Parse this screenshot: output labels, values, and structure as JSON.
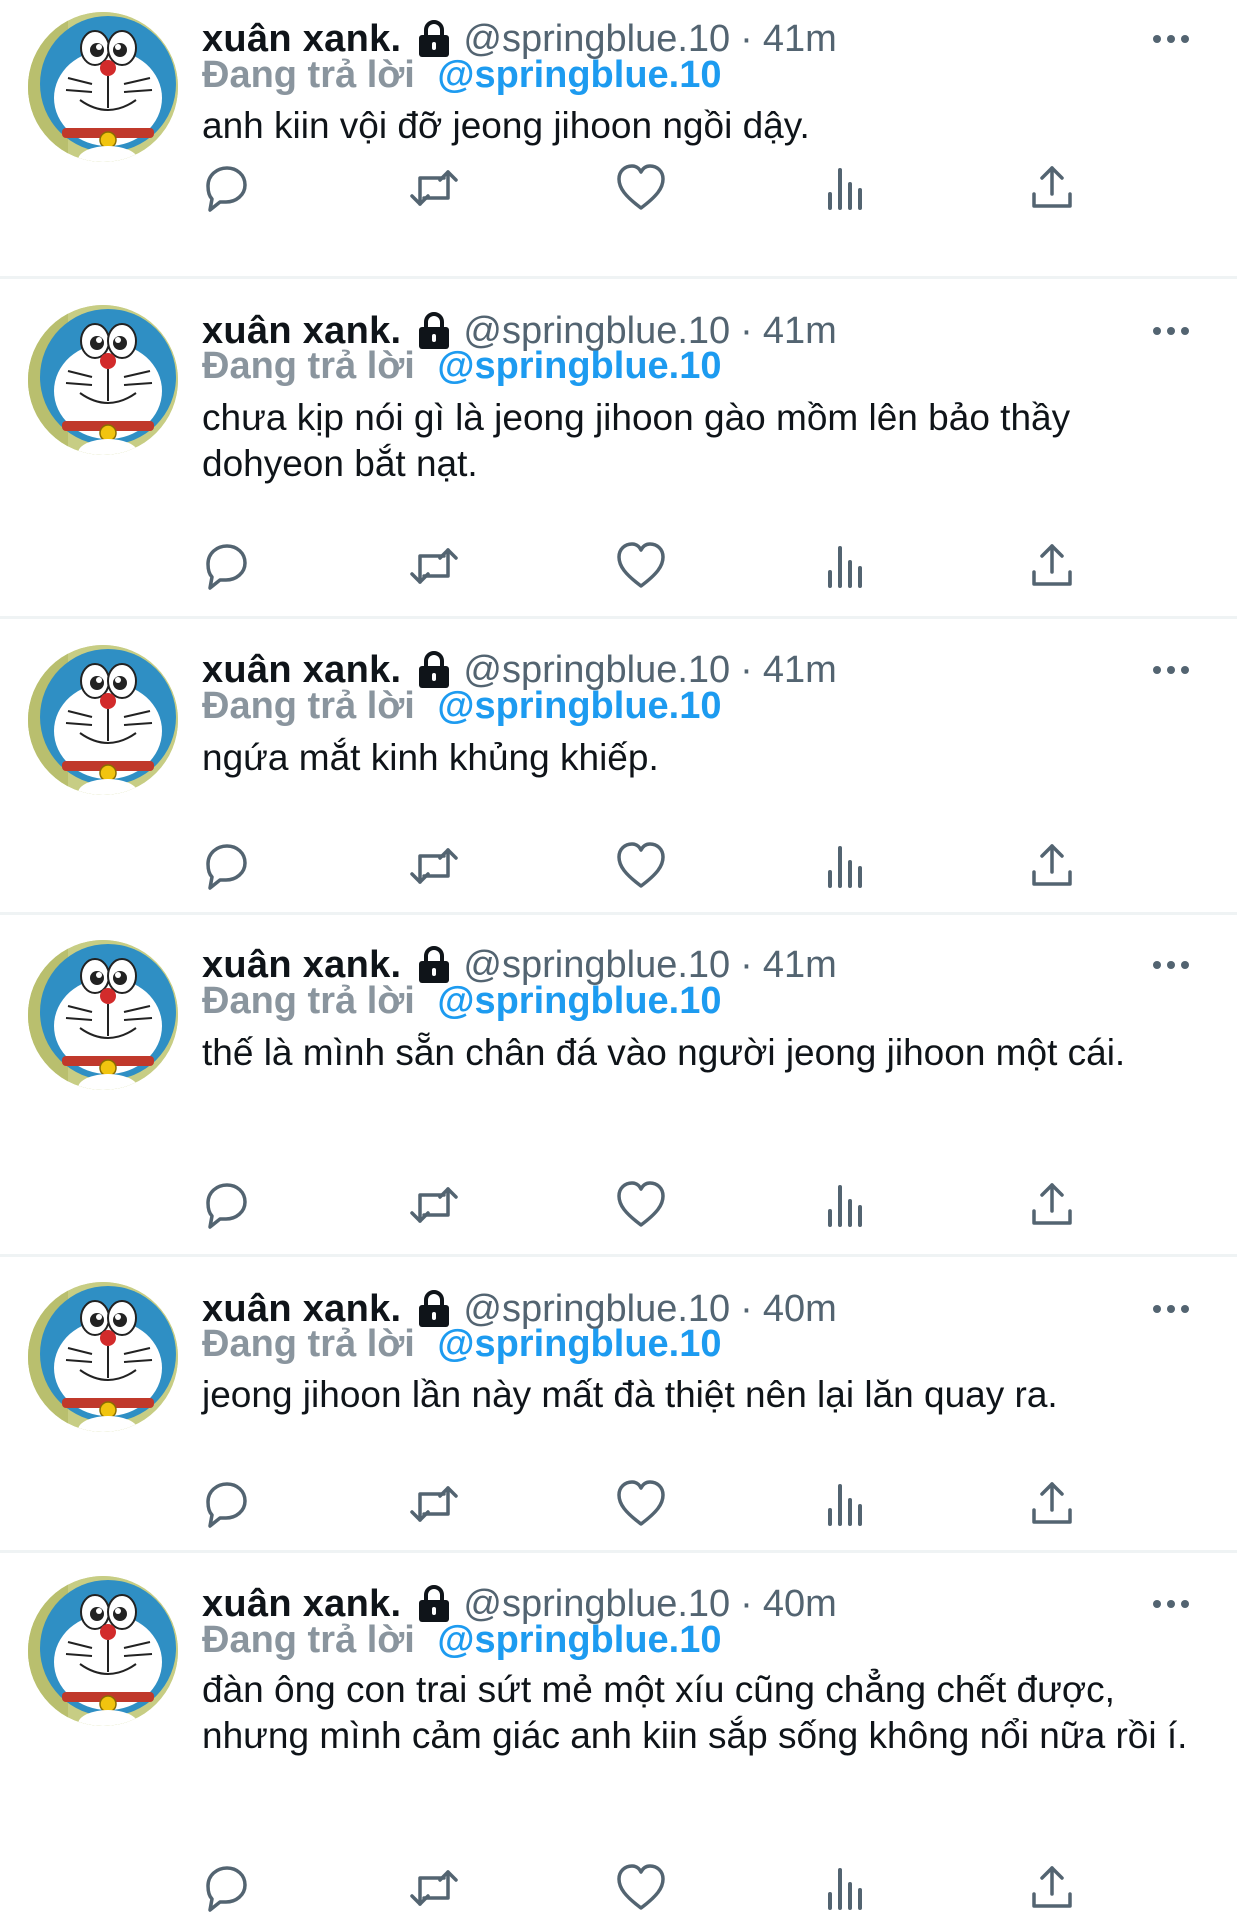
{
  "icons": {
    "reply": "reply-icon",
    "retweet": "retweet-icon",
    "like": "heart-icon",
    "views": "views-icon",
    "share": "share-icon",
    "lock": "lock-icon",
    "more": "more-icon"
  },
  "colors": {
    "link": "#1d9bf0",
    "muted": "#536471",
    "icon": "#536471"
  },
  "tweets": [
    {
      "name": "xuân xank.",
      "handle": "@springblue.10",
      "dot": "·",
      "time": "41m",
      "reply_prefix": "Đang trả lời",
      "reply_handle": "@springblue.10",
      "text": "anh kiin vội đỡ jeong jihoon ngồi dậy."
    },
    {
      "name": "xuân xank.",
      "handle": "@springblue.10",
      "dot": "·",
      "time": "41m",
      "reply_prefix": "Đang trả lời",
      "reply_handle": "@springblue.10",
      "text": "chưa kịp nói gì là jeong jihoon gào mồm lên bảo thầy dohyeon bắt nạt."
    },
    {
      "name": "xuân xank.",
      "handle": "@springblue.10",
      "dot": "·",
      "time": "41m",
      "reply_prefix": "Đang trả lời",
      "reply_handle": "@springblue.10",
      "text": "ngứa mắt kinh khủng khiếp."
    },
    {
      "name": "xuân xank.",
      "handle": "@springblue.10",
      "dot": "·",
      "time": "41m",
      "reply_prefix": "Đang trả lời",
      "reply_handle": "@springblue.10",
      "text": "thế là mình sẵn chân đá vào người jeong jihoon một cái."
    },
    {
      "name": "xuân xank.",
      "handle": "@springblue.10",
      "dot": "·",
      "time": "40m",
      "reply_prefix": "Đang trả lời",
      "reply_handle": "@springblue.10",
      "text": "jeong jihoon lần này mất đà thiệt nên lại lăn quay ra."
    },
    {
      "name": "xuân xank.",
      "handle": "@springblue.10",
      "dot": "·",
      "time": "40m",
      "reply_prefix": "Đang trả lời",
      "reply_handle": "@springblue.10",
      "text": "đàn ông con trai sứt mẻ một xíu cũng chẳng chết được, nhưng mình cảm giác anh kiin sắp sống không nổi nữa rồi í."
    }
  ]
}
